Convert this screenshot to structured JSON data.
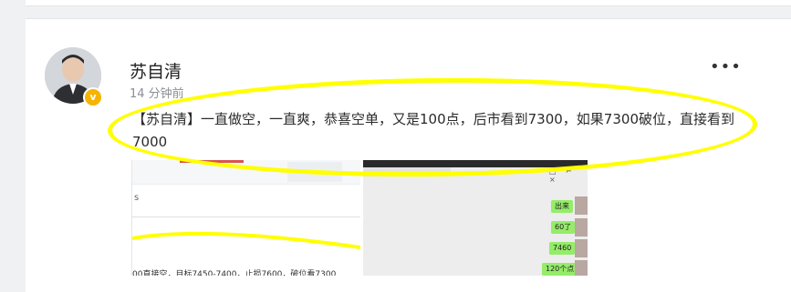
{
  "post": {
    "author": "苏自清",
    "timestamp": "14 分钟前",
    "more_icon": "•••",
    "verified_badge": "v",
    "text": "【苏自清】一直做空，一直爽，恭喜空单，又是100点，后市看到7300，如果7300破位，直接看到7000"
  },
  "attachments": {
    "left_image": {
      "side_text": "s",
      "bottom_text": "00直接空，目标7450-7400，止损7600，破位看7300"
    },
    "right_image": {
      "icons": "□ ⌐ ×",
      "bubbles": [
        "出来",
        "60了",
        "7460",
        "120个点"
      ]
    }
  },
  "annotation": {
    "color": "#ffff00"
  }
}
